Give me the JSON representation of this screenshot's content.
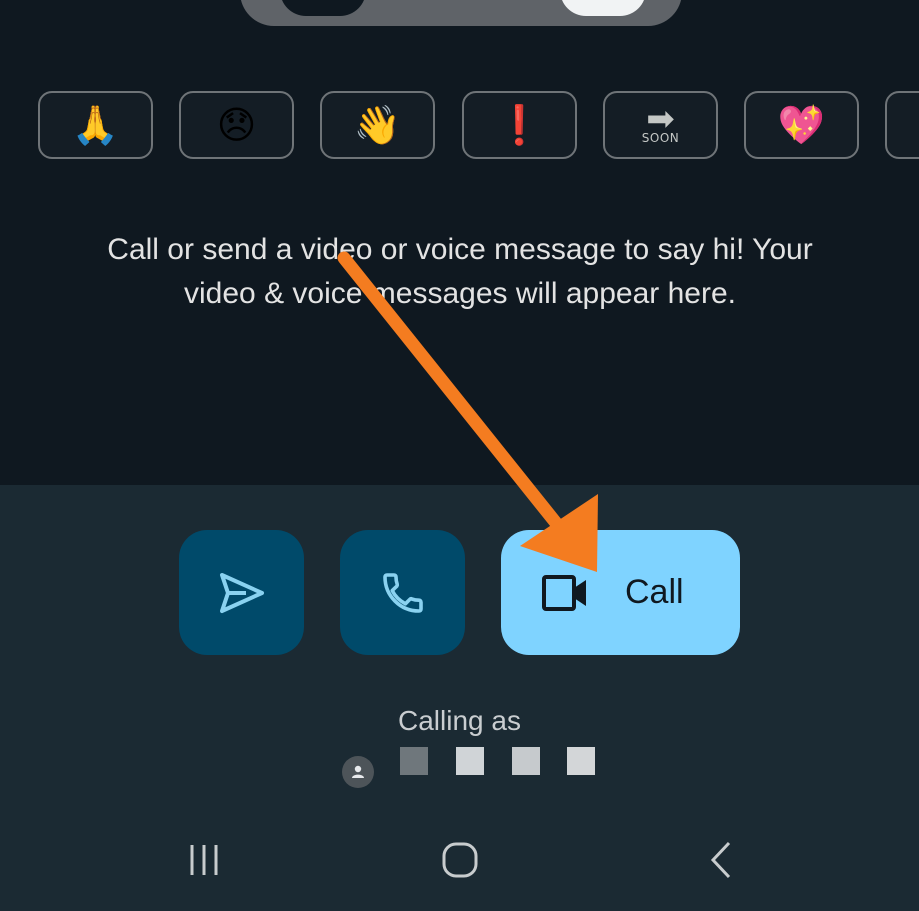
{
  "reactions": [
    {
      "name": "folded-hands",
      "glyph": "🙏"
    },
    {
      "name": "disappointed-face",
      "glyph": "😞"
    },
    {
      "name": "waving-hand",
      "glyph": "👋"
    },
    {
      "name": "exclamation-mark",
      "glyph": "❗"
    },
    {
      "name": "soon-arrow",
      "glyph": "➡",
      "text": "SOON"
    },
    {
      "name": "sparkling-heart",
      "glyph": "💖"
    }
  ],
  "empty_state": {
    "message": "Call or send a video or voice message to say hi! Your video & voice messages will appear here."
  },
  "actions": {
    "send_icon": "send-icon",
    "voice_icon": "phone-icon",
    "call_icon": "video-camera-icon",
    "call_label": "Call"
  },
  "account": {
    "calling_as": "Calling as",
    "avatar_icon": "person-icon",
    "redacted_colors": [
      "#6f777c",
      "#d0d4d7",
      "#c6cacd",
      "#d3d6d8"
    ]
  },
  "navbar": [
    "recent-apps-icon",
    "home-icon",
    "back-icon"
  ],
  "colors": {
    "background": "#0f1820",
    "bottom_panel": "#1b2a33",
    "action_button": "#004a6a",
    "call_button": "#7fd3ff",
    "annotation_arrow": "#f47c20"
  }
}
